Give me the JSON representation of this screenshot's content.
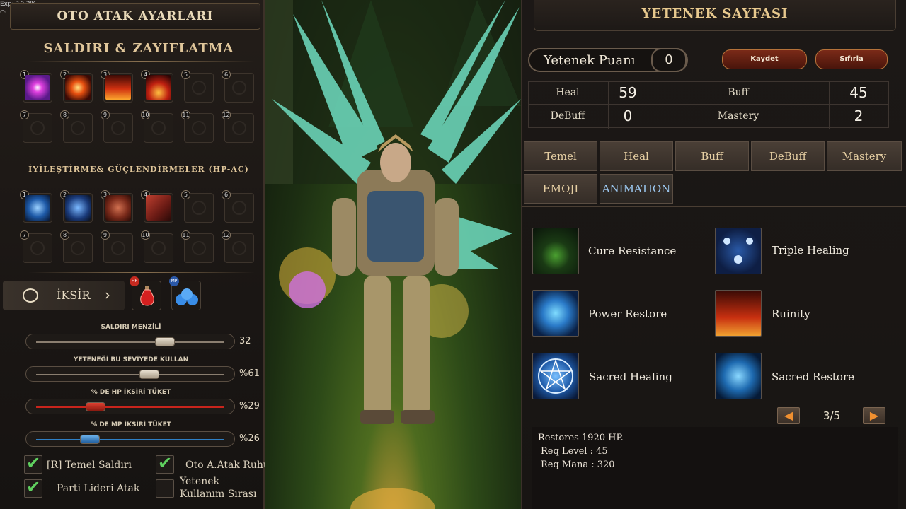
{
  "left": {
    "title": "OTO ATAK AYARLARI",
    "status_bar": "Exp: 10,2%",
    "attack_section_title": "SALDIRI & ZAYIFLATMA",
    "attack_slots": [
      "1",
      "2",
      "3",
      "4",
      "5",
      "6",
      "7",
      "8",
      "9",
      "10",
      "11",
      "12"
    ],
    "heal_section_title": "İYİLEŞTİRME& GÜÇLENDİRMELER (HP-AC)",
    "heal_slots": [
      "1",
      "2",
      "3",
      "4",
      "5",
      "6",
      "7",
      "8",
      "9",
      "10",
      "11",
      "12"
    ],
    "potion_label": "İKSİR",
    "potion_badge": "HP",
    "mp_badge": "MP",
    "sliders": [
      {
        "label": "SALDIRI MENZİLİ",
        "value": "32",
        "level": 0.7
      },
      {
        "label": "YETENEĞİ BU SEVİYEDE KULLAN",
        "value": "%61",
        "level": 0.61
      },
      {
        "label": "% DE HP İKSİRİ TÜKET",
        "value": "%29",
        "level": 0.29
      },
      {
        "label": "% DE MP İKSİRİ TÜKET",
        "value": "%26",
        "level": 0.26
      }
    ],
    "checkboxes": [
      {
        "label": "[R] Temel Saldırı",
        "checked": true
      },
      {
        "label": "Oto A.Atak Ruhu",
        "checked": true
      },
      {
        "label": "Parti Lideri Atak",
        "checked": true
      },
      {
        "label": "Yetenek Kullanım Sırası",
        "checked": false
      }
    ],
    "colors": {
      "hp_track": "#c8241c",
      "mp_track": "#2e7fc4",
      "check": "#5fd05f"
    }
  },
  "right": {
    "title": "YETENEK SAYFASI",
    "points_label": "Yetenek Puanı",
    "points_value": "0",
    "save_button": "Kaydet",
    "reset_button": "Sıfırla",
    "stats": [
      {
        "label": "Heal",
        "value": "59"
      },
      {
        "label": "Buff",
        "value": "45"
      },
      {
        "label": "DeBuff",
        "value": "0"
      },
      {
        "label": "Mastery",
        "value": "2"
      }
    ],
    "tabs": [
      "Temel",
      "Heal",
      "Buff",
      "DeBuff",
      "Mastery",
      "EMOJI",
      "ANIMATION"
    ],
    "selected_tab": "ANIMATION",
    "skills": [
      {
        "name": "Cure Resistance",
        "icon": "hooded-figure-icon"
      },
      {
        "name": "Triple Healing",
        "icon": "triple-star-icon"
      },
      {
        "name": "Power Restore",
        "icon": "blue-figure-icon"
      },
      {
        "name": "Ruinity",
        "icon": "fire-burst-icon"
      },
      {
        "name": "Sacred Healing",
        "icon": "pentagram-icon"
      },
      {
        "name": "Sacred Restore",
        "icon": "glowing-figure-icon"
      }
    ],
    "page": "3/5",
    "description": [
      "Restores 1920 HP.",
      "Req Level : 45",
      "Req Mana : 320"
    ],
    "accent": "#e8c98e"
  }
}
